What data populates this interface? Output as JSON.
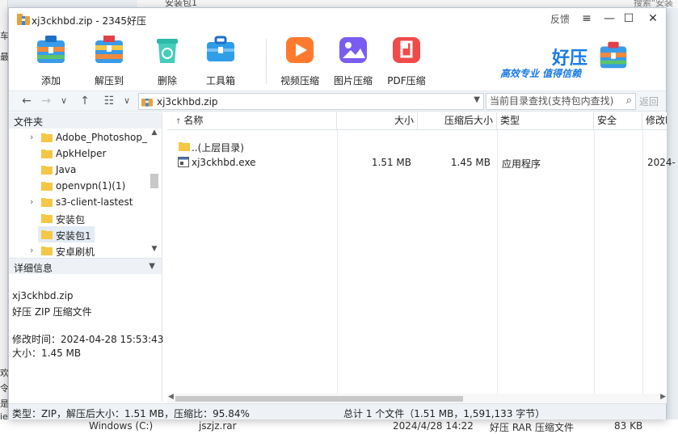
{
  "background": {
    "left_chars": [
      "车",
      "最",
      "欢",
      "令",
      "是",
      "ie"
    ],
    "top_crumb": "安装包1",
    "top_search": "搜索\"安装",
    "bottom_row": {
      "name1": "Windows (C:)",
      "name2": "jszjz.rar",
      "date": "2024/4/28 14:22",
      "type": "好压 RAR 压缩文件",
      "size": "83 KB"
    }
  },
  "window": {
    "title": "xj3ckhbd.zip - 2345好压",
    "feedback": "反馈",
    "controls": {
      "menu": "≡",
      "minimize": "—",
      "maximize": "☐",
      "close": "✕"
    }
  },
  "toolbar": {
    "buttons": [
      {
        "key": "add",
        "label": "添加",
        "icon": "add-archive-icon"
      },
      {
        "key": "extract",
        "label": "解压到",
        "icon": "extract-icon"
      },
      {
        "key": "delete",
        "label": "删除",
        "icon": "recycle-bin-icon"
      },
      {
        "key": "toolbox",
        "label": "工具箱",
        "icon": "toolbox-icon"
      },
      {
        "key": "video",
        "label": "视频压缩",
        "icon": "video-compress-icon"
      },
      {
        "key": "image",
        "label": "图片压缩",
        "icon": "image-compress-icon"
      },
      {
        "key": "pdf",
        "label": "PDF压缩",
        "icon": "pdf-compress-icon"
      }
    ],
    "brand": {
      "name": "好压",
      "slogan": "高效专业  值得信赖"
    }
  },
  "nav": {
    "back": "←",
    "forward": "→",
    "history": "∨",
    "up": "↑",
    "view": "☷",
    "view_dd": "∨",
    "path": "xj3ckhbd.zip",
    "search_placeholder": "当前目录查找(支持包内查找)",
    "return": "返回"
  },
  "folder_pane": {
    "title": "文件夹",
    "items": [
      {
        "name": "Adobe_Photoshop_",
        "expandable": true
      },
      {
        "name": "ApkHelper",
        "expandable": false
      },
      {
        "name": "Java",
        "expandable": false
      },
      {
        "name": "openvpn(1)(1)",
        "expandable": false
      },
      {
        "name": "s3-client-lastest",
        "expandable": true
      },
      {
        "name": "安装包",
        "expandable": false
      },
      {
        "name": "安装包1",
        "expandable": false,
        "selected": true
      },
      {
        "name": "安卓刷机",
        "expandable": true
      }
    ]
  },
  "details_pane": {
    "title": "详细信息",
    "filename": "xj3ckhbd.zip",
    "filetype": "好压 ZIP 压缩文件",
    "modified": "修改时间：2024-04-28 15:53:43",
    "size": "大小：1.45 MB"
  },
  "file_list": {
    "columns": {
      "name": "名称",
      "size": "大小",
      "packed": "压缩后大小",
      "type": "类型",
      "security": "安全",
      "modified": "修改时"
    },
    "rows": [
      {
        "name": "..(上层目录)",
        "size": "",
        "packed": "",
        "type": "",
        "security": "",
        "modified": "",
        "icon": "folder-icon"
      },
      {
        "name": "xj3ckhbd.exe",
        "size": "1.51 MB",
        "packed": "1.45 MB",
        "type": "应用程序",
        "security": "",
        "modified": "2024-",
        "icon": "exe-icon"
      }
    ]
  },
  "status": {
    "left": "类型：ZIP，解压后大小：1.51 MB，压缩比：95.84%",
    "right": "总计 1 个文件（1.51 MB，1,591,133 字节）"
  },
  "colors": {
    "accent": "#1a7be6",
    "folder": "#f5c746",
    "selected": "#e3ecf7"
  }
}
